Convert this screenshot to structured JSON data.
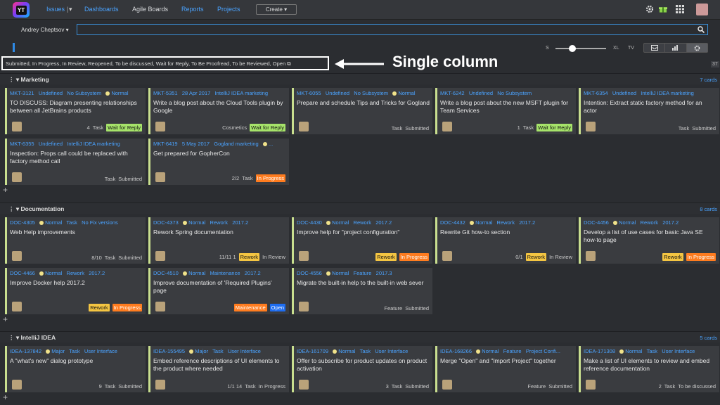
{
  "nav": {
    "logo": "YT",
    "issues": "Issues",
    "dashboards": "Dashboards",
    "agile": "Agile Boards",
    "reports": "Reports",
    "projects": "Projects",
    "create": "Create"
  },
  "search": {
    "user": "Andrey Cheptsov"
  },
  "size": {
    "s": "S",
    "xl": "XL",
    "tv": "TV"
  },
  "query": "Submitted, In Progress, In Review, Reopened, To be discussed, Wait for Reply, To Be Proofread, To be Reviewed, Open",
  "annotation": "Single column",
  "count": "37",
  "swimlanes": [
    {
      "name": "Marketing",
      "count": "7 cards",
      "cards": [
        {
          "id": "MKT-3121",
          "meta": [
            "Undefined",
            "No Subsystem"
          ],
          "prio": "Normal",
          "title": "TO DISCUSS: Diagram presenting relationships between all JetBrains products",
          "foot": "4",
          "type": "Task",
          "tag": "Wait for Reply",
          "tagc": "green"
        },
        {
          "id": "MKT-5351",
          "meta": [
            "28 Apr 2017",
            "IntelliJ IDEA marketing"
          ],
          "prio": "",
          "title": "Write a blog post about the Cloud Tools plugin by Google",
          "foot": "",
          "type": "Cosmetics",
          "tag": "Wait for Reply",
          "tagc": "green"
        },
        {
          "id": "MKT-6055",
          "meta": [
            "Undefined",
            "No Subsystem"
          ],
          "prio": "Normal",
          "title": "Prepare and schedule Tips and Tricks for Gogland",
          "foot": "",
          "type": "Task",
          "tag": "Submitted",
          "tagc": ""
        },
        {
          "id": "MKT-6242",
          "meta": [
            "Undefined",
            "No Subsystem"
          ],
          "prio": "",
          "title": "Write a blog post about the new MSFT plugin for Team Services",
          "foot": "1",
          "type": "Task",
          "tag": "Wait for Reply",
          "tagc": "green"
        },
        {
          "id": "MKT-6354",
          "meta": [
            "Undefined",
            "IntelliJ IDEA marketing"
          ],
          "prio": "",
          "title": "Intention: Extract static factory method for an actor",
          "foot": "",
          "type": "Task",
          "tag": "Submitted",
          "tagc": ""
        },
        {
          "id": "MKT-6355",
          "meta": [
            "Undefined",
            "IntelliJ IDEA marketing"
          ],
          "prio": "",
          "title": "Inspection: Props call could be replaced with factory method call",
          "foot": "",
          "type": "Task",
          "tag": "Submitted",
          "tagc": ""
        },
        {
          "id": "MKT-6419",
          "meta": [
            "5 May 2017",
            "Gogland marketing"
          ],
          "prio": "...",
          "title": "Get prepared for GopherCon",
          "foot": "2/2",
          "type": "Task",
          "tag": "In Progress",
          "tagc": "orange"
        }
      ]
    },
    {
      "name": "Documentation",
      "count": "8 cards",
      "cards": [
        {
          "id": "DOC-4305",
          "meta": [],
          "prio": "Normal",
          "extra": "Task   No Fix versions",
          "title": "Web Help improvements",
          "foot": "8/10",
          "type": "Task",
          "tag": "Submitted",
          "tagc": ""
        },
        {
          "id": "DOC-4373",
          "meta": [],
          "prio": "Normal",
          "extra": "Rework   2017.2",
          "title": "Rework Spring documentation",
          "foot": "11/11  1",
          "type": "",
          "tag": "Rework",
          "tagc": "yellow",
          "tag2": "In Review"
        },
        {
          "id": "DOC-4430",
          "meta": [],
          "prio": "Normal",
          "extra": "Rework   2017.2",
          "title": "Improve help for \"project configuration\"",
          "foot": "",
          "type": "",
          "tag": "Rework",
          "tagc": "yellow",
          "tag3": "In Progress"
        },
        {
          "id": "DOC-4432",
          "meta": [],
          "prio": "Normal",
          "extra": "Rework   2017.2",
          "title": "Rewrite Git how-to section",
          "foot": "0/1",
          "type": "",
          "tag": "Rework",
          "tagc": "yellow",
          "tag2": "In Review"
        },
        {
          "id": "DOC-4456",
          "meta": [],
          "prio": "Normal",
          "extra": "Rework   2017.2",
          "title": "Develop a list of use cases for basic Java SE how-to page",
          "foot": "",
          "type": "",
          "tag": "Rework",
          "tagc": "yellow",
          "tag3": "In Progress"
        },
        {
          "id": "DOC-4466",
          "meta": [],
          "prio": "Normal",
          "extra": "Rework   2017.2",
          "title": "Improve Docker help 2017.2",
          "foot": "",
          "type": "",
          "tag": "Rework",
          "tagc": "yellow",
          "tag3": "In Progress"
        },
        {
          "id": "DOC-4510",
          "meta": [],
          "prio": "Normal",
          "extra": "Maintenance   2017.2",
          "title": "Improve documentation of 'Required Plugins' page",
          "foot": "",
          "type": "",
          "tag": "Maintenance",
          "tagc": "orange",
          "tag4": "Open"
        },
        {
          "id": "DOC-4556",
          "meta": [],
          "prio": "Normal",
          "extra": "Feature   2017.3",
          "title": "Migrate the built-in help to the built-in web sever",
          "foot": "",
          "type": "Feature",
          "tag": "Submitted",
          "tagc": ""
        }
      ]
    },
    {
      "name": "IntelliJ IDEA",
      "count": "5 cards",
      "cards": [
        {
          "id": "IDEA-137842",
          "meta": [],
          "prio": "Major",
          "extra": "Task   User Interface",
          "title": "A \"what's new\" dialog prototype",
          "foot": "9",
          "type": "Task",
          "tag": "Submitted",
          "tagc": ""
        },
        {
          "id": "IDEA-155495",
          "meta": [],
          "prio": "Major",
          "extra": "Task   User Interface",
          "title": "Embed reference descriptions of UI elements to the product where needed",
          "foot": "1/1  14",
          "type": "Task",
          "tag": "In Progress",
          "tagc": ""
        },
        {
          "id": "IDEA-161709",
          "meta": [],
          "prio": "Normal",
          "extra": "Task   User Interface",
          "title": "Offer to subscribe for product updates on product activation",
          "foot": "3",
          "type": "Task",
          "tag": "Submitted",
          "tagc": ""
        },
        {
          "id": "IDEA-168266",
          "meta": [],
          "prio": "Normal",
          "extra": "Feature   Project Confi...",
          "title": "Merge \"Open\" and \"Import Project\" together",
          "foot": "",
          "type": "Feature",
          "tag": "Submitted",
          "tagc": ""
        },
        {
          "id": "IDEA-171308",
          "meta": [],
          "prio": "Normal",
          "extra": "Task   User Interface",
          "title": "Make a list of UI elements to review and embed reference documentation",
          "foot": "2",
          "type": "Task",
          "tag": "To be discussed",
          "tagc": ""
        }
      ]
    }
  ]
}
